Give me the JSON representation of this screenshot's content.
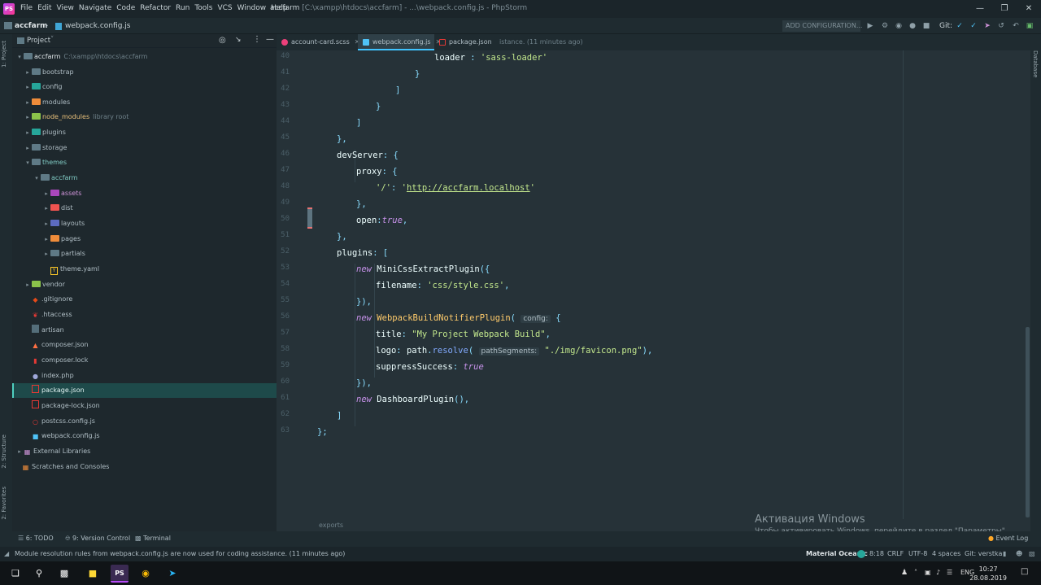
{
  "menubar": {
    "items": [
      "File",
      "Edit",
      "View",
      "Navigate",
      "Code",
      "Refactor",
      "Run",
      "Tools",
      "VCS",
      "Window",
      "Help"
    ],
    "project_name": "accfarm",
    "title_path": "[C:\\xampp\\htdocs\\accfarm] - ...\\webpack.config.js - PhpStorm"
  },
  "navbar": {
    "project": "accfarm",
    "file": "webpack.config.js",
    "run_config": "ADD CONFIGURATION...",
    "git_label": "Git:"
  },
  "left_strip": {
    "project": "1: Project",
    "structure": "2: Structure",
    "favorites": "2: Favorites"
  },
  "right_strip": {
    "database": "Database"
  },
  "project_panel": {
    "header": "Project",
    "root": {
      "name": "accfarm",
      "path": "C:\\xampp\\htdocs\\accfarm"
    },
    "items": [
      {
        "name": "bootstrap",
        "type": "folder"
      },
      {
        "name": "config",
        "type": "folder"
      },
      {
        "name": "modules",
        "type": "folder"
      },
      {
        "name": "node_modules",
        "type": "folder",
        "note": "library root"
      },
      {
        "name": "plugins",
        "type": "folder"
      },
      {
        "name": "storage",
        "type": "folder"
      },
      {
        "name": "themes",
        "type": "folder"
      },
      {
        "name": "accfarm",
        "type": "folder"
      },
      {
        "name": "assets",
        "type": "folder"
      },
      {
        "name": "dist",
        "type": "folder"
      },
      {
        "name": "layouts",
        "type": "folder"
      },
      {
        "name": "pages",
        "type": "folder"
      },
      {
        "name": "partials",
        "type": "folder"
      },
      {
        "name": "theme.yaml",
        "type": "file"
      },
      {
        "name": "vendor",
        "type": "folder"
      },
      {
        "name": ".gitignore",
        "type": "file"
      },
      {
        "name": ".htaccess",
        "type": "file"
      },
      {
        "name": "artisan",
        "type": "file"
      },
      {
        "name": "composer.json",
        "type": "file"
      },
      {
        "name": "composer.lock",
        "type": "file"
      },
      {
        "name": "index.php",
        "type": "file"
      },
      {
        "name": "package.json",
        "type": "file"
      },
      {
        "name": "package-lock.json",
        "type": "file"
      },
      {
        "name": "postcss.config.js",
        "type": "file"
      },
      {
        "name": "webpack.config.js",
        "type": "file"
      },
      {
        "name": "External Libraries",
        "type": "lib"
      },
      {
        "name": "Scratches and Consoles",
        "type": "scratch"
      }
    ]
  },
  "tabs": [
    {
      "label": "account-card.scss"
    },
    {
      "label": "webpack.config.js"
    },
    {
      "label": "package.json"
    }
  ],
  "tab_hint": "istance. (11 minutes ago)",
  "editor": {
    "line_numbers": [
      "40",
      "41",
      "42",
      "43",
      "44",
      "45",
      "46",
      "47",
      "48",
      "49",
      "50",
      "51",
      "52",
      "53",
      "54",
      "55",
      "56",
      "57",
      "58",
      "59",
      "60",
      "61",
      "62",
      "63"
    ],
    "breadcrumb": "exports"
  },
  "code": {
    "l40_key": "loader",
    "l40_val": "'sass-loader'",
    "l45": "},",
    "l46_key": "devServer",
    "l47_key": "proxy",
    "l48_key": "'/'",
    "l48_url": "http://accfarm.localhost",
    "l49": "},",
    "l50_key": "open",
    "l50_val": "true",
    "l51": "},",
    "l52_key": "plugins",
    "l53_kw": "new",
    "l53_fn": "MiniCssExtractPlugin",
    "l54_key": "filename",
    "l54_val": "'css/style.css'",
    "l55": "}),",
    "l56_kw": "new",
    "l56_fn": "WebpackBuildNotifierPlugin",
    "l56_hint": "config:",
    "l57_key": "title",
    "l57_val": "\"My Project Webpack Build\"",
    "l58_key": "logo",
    "l58_obj": "path",
    "l58_fn": "resolve",
    "l58_hint": "pathSegments:",
    "l58_val": "\"./img/favicon.png\"",
    "l59_key": "suppressSuccess",
    "l59_val": "true",
    "l60": "}),",
    "l61_kw": "new",
    "l61_fn": "DashboardPlugin",
    "l62": "]",
    "l63": "};"
  },
  "watermark": {
    "title": "Активация Windows",
    "subtitle": "Чтобы активировать Windows, перейдите в раздел \"Параметры\"."
  },
  "tool_tabs": {
    "todo": "6: TODO",
    "vcs": "9: Version Control",
    "terminal": "Terminal",
    "event_log": "Event Log"
  },
  "statusbar": {
    "message": "Module resolution rules from webpack.config.js are now used for coding assistance. (11 minutes ago)",
    "theme": "Material Oceanic",
    "position": "8:18",
    "line_sep": "CRLF",
    "encoding": "UTF-8",
    "indent": "4 spaces",
    "git": "Git: verstka"
  },
  "taskbar": {
    "lang": "ENG",
    "time": "10:27",
    "date": "28.08.2019"
  }
}
